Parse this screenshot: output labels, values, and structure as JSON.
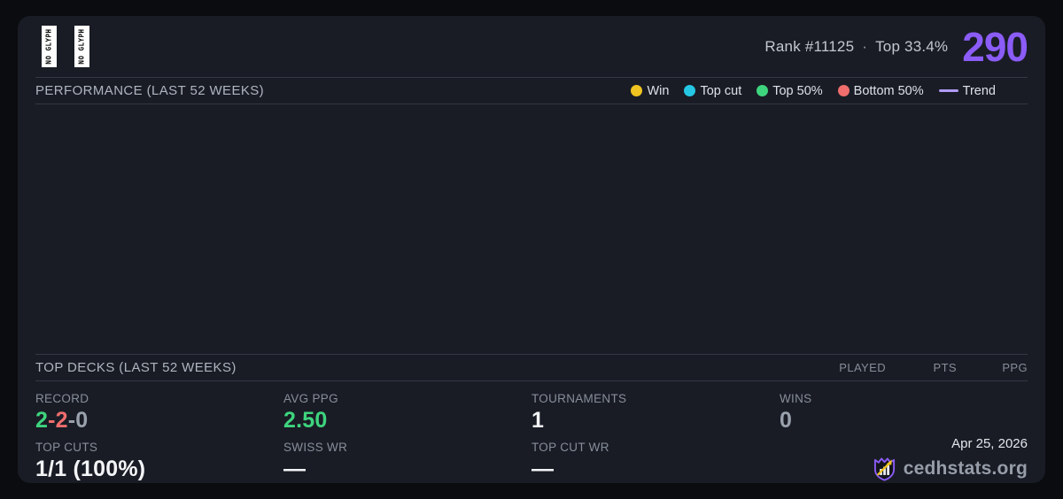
{
  "page": {
    "background": "#0b0c10",
    "card_background": "#191c25",
    "accent": "#8b5cf6",
    "divider_color": "#313744"
  },
  "header": {
    "commander_glyphs": [
      {
        "text": "NO GLYPH"
      },
      {
        "text": "NO GLYPH"
      }
    ],
    "rank_label": "Rank #11125",
    "dot_separator": "·",
    "top_percent_label": "Top 33.4%",
    "points_value": "290"
  },
  "performance_section": {
    "title": "PERFORMANCE (LAST 52 WEEKS)",
    "legend": [
      {
        "label": "Win",
        "color": "#f0c420",
        "marker": "dot"
      },
      {
        "label": "Top cut",
        "color": "#25c7e5",
        "marker": "dot"
      },
      {
        "label": "Top 50%",
        "color": "#3ed47e",
        "marker": "dot"
      },
      {
        "label": "Bottom 50%",
        "color": "#ef6d6d",
        "marker": "dot"
      },
      {
        "label": "Trend",
        "color": "#b09af5",
        "marker": "line"
      }
    ],
    "chart_empty": true
  },
  "top_decks_section": {
    "title": "TOP DECKS (LAST 52 WEEKS)",
    "columns": [
      "PLAYED",
      "PTS",
      "PPG"
    ],
    "rows": []
  },
  "stats": {
    "record": {
      "label": "RECORD",
      "parts": [
        {
          "text": "2",
          "color": "#3ed47e"
        },
        {
          "text": "-",
          "color": "#ef6d6d"
        },
        {
          "text": "2",
          "color": "#ef6d6d"
        },
        {
          "text": "-",
          "color": "#99a1ac"
        },
        {
          "text": "0",
          "color": "#99a1ac"
        }
      ]
    },
    "avg_ppg": {
      "label": "AVG PPG",
      "value": "2.50",
      "color": "#3ed47e"
    },
    "tournaments": {
      "label": "TOURNAMENTS",
      "value": "1",
      "color": "#f3f4f6"
    },
    "wins": {
      "label": "WINS",
      "value": "0",
      "color": "#99a1ac"
    },
    "top_cuts": {
      "label": "TOP CUTS",
      "value": "1/1 (100%)",
      "color": "#ffffff"
    },
    "swiss_wr": {
      "label": "SWISS WR",
      "value": "—",
      "color": "#ffffff"
    },
    "top_cut_wr": {
      "label": "TOP CUT WR",
      "value": "—",
      "color": "#ffffff"
    }
  },
  "footer": {
    "date": "Apr 25, 2026",
    "brand": "cedhstats.org",
    "logo_colors": {
      "shield_stroke": "#8b5cf6",
      "shield_fill": "#14151c",
      "bars": "#e8eaf0",
      "arrow": "#f0c41f"
    }
  }
}
